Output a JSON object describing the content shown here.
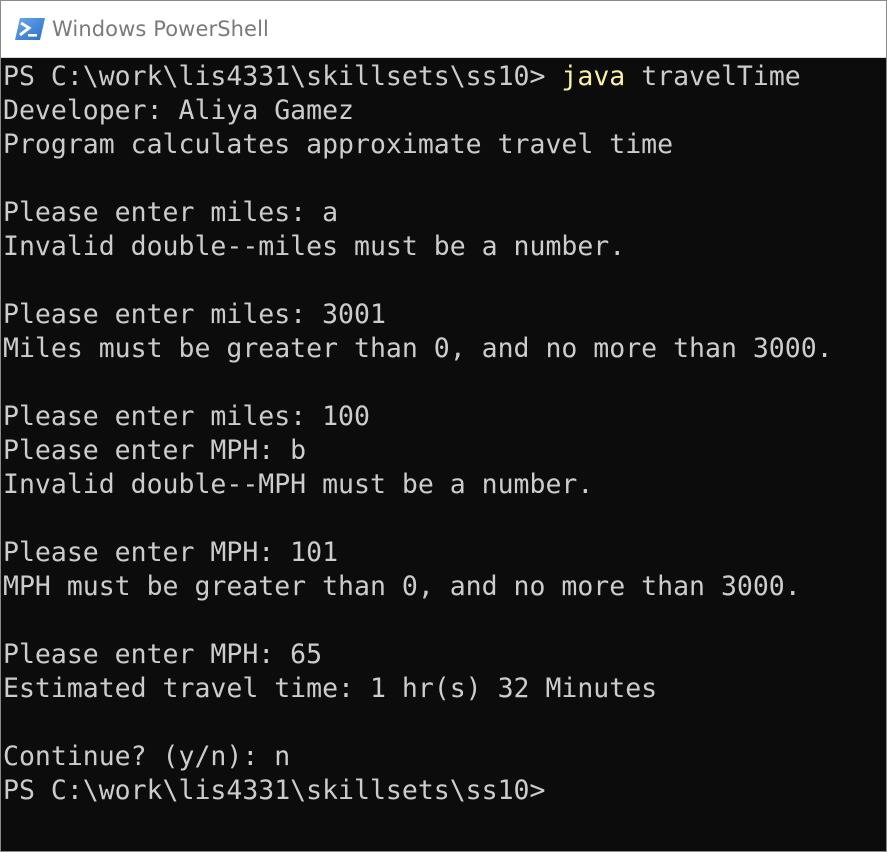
{
  "window": {
    "title": "Windows PowerShell",
    "icon": "powershell-icon",
    "colors": {
      "background": "#0c0c0c",
      "foreground": "#cccccc",
      "command": "#f9f1a5",
      "title_text": "#7a7a7a"
    }
  },
  "console": {
    "prompt_line": {
      "prompt": "PS C:\\work\\lis4331\\skillsets\\ss10> ",
      "command": "java",
      "args": " travelTime"
    },
    "lines": [
      "Developer: Aliya Gamez",
      "Program calculates approximate travel time",
      "",
      "Please enter miles: a",
      "Invalid double--miles must be a number.",
      "",
      "Please enter miles: 3001",
      "Miles must be greater than 0, and no more than 3000.",
      "",
      "Please enter miles: 100",
      "Please enter MPH: b",
      "Invalid double--MPH must be a number.",
      "",
      "Please enter MPH: 101",
      "MPH must be greater than 0, and no more than 3000.",
      "",
      "Please enter MPH: 65",
      "Estimated travel time: 1 hr(s) 32 Minutes",
      "",
      "Continue? (y/n): n"
    ],
    "final_prompt": "PS C:\\work\\lis4331\\skillsets\\ss10>"
  }
}
